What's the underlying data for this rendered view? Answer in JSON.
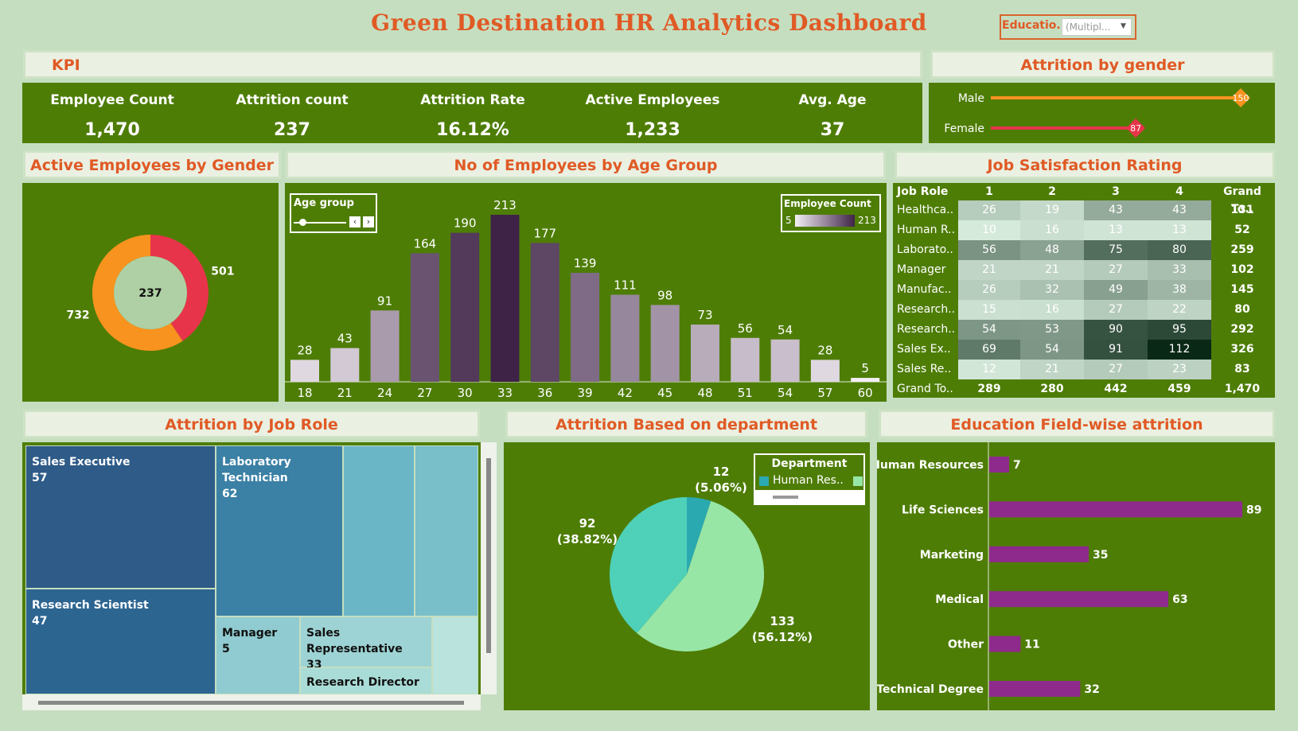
{
  "title": "Green Destination HR Analytics Dashboard",
  "filter": {
    "label": "Educatio..",
    "value": "(Multipl..."
  },
  "kpi": {
    "header": "KPI",
    "items": [
      {
        "label": "Employee Count",
        "value": "1,470"
      },
      {
        "label": "Attrition count",
        "value": "237"
      },
      {
        "label": "Attrition Rate",
        "value": "16.12%"
      },
      {
        "label": "Active Employees",
        "value": "1,233"
      },
      {
        "label": "Avg. Age",
        "value": "37"
      }
    ]
  },
  "colors": {
    "panel_green": "#4e7d06",
    "header_orange": "#e05a25",
    "male_orange": "#f7931e",
    "female_red": "#e8344a",
    "edu_bar": "#8e2a8c"
  },
  "chart_data": [
    {
      "id": "attrition_by_gender",
      "type": "bar",
      "title": "Attrition by gender",
      "categories": [
        "Male",
        "Female"
      ],
      "values": [
        150,
        87
      ],
      "xlim": [
        0,
        165
      ]
    },
    {
      "id": "active_by_gender",
      "type": "pie",
      "title": "Active Employees by Gender",
      "center_label": "237",
      "slices": [
        {
          "value": 501,
          "color": "#e8344a"
        },
        {
          "value": 732,
          "color": "#f7931e"
        }
      ]
    },
    {
      "id": "age_group",
      "type": "bar",
      "title": "No of Employees by Age Group",
      "categories": [
        "18",
        "21",
        "24",
        "27",
        "30",
        "33",
        "36",
        "39",
        "42",
        "45",
        "48",
        "51",
        "54",
        "57",
        "60"
      ],
      "values": [
        28,
        43,
        91,
        164,
        190,
        213,
        177,
        139,
        111,
        98,
        73,
        56,
        54,
        28,
        5
      ],
      "color_scale": {
        "title": "Employee Count",
        "min": 5,
        "max": 213
      },
      "filter_label": "Age group"
    },
    {
      "id": "job_satisfaction",
      "type": "heatmap",
      "title": "Job Satisfaction Rating",
      "columns": [
        "Job Role",
        "1",
        "2",
        "3",
        "4",
        "Grand To.."
      ],
      "rows": [
        {
          "label": "Healthca..",
          "values": [
            26,
            19,
            43,
            43
          ],
          "total": "131"
        },
        {
          "label": "Human R..",
          "values": [
            10,
            16,
            13,
            13
          ],
          "total": "52"
        },
        {
          "label": "Laborato..",
          "values": [
            56,
            48,
            75,
            80
          ],
          "total": "259"
        },
        {
          "label": "Manager",
          "values": [
            21,
            21,
            27,
            33
          ],
          "total": "102"
        },
        {
          "label": "Manufac..",
          "values": [
            26,
            32,
            49,
            38
          ],
          "total": "145"
        },
        {
          "label": "Research..",
          "values": [
            15,
            16,
            27,
            22
          ],
          "total": "80"
        },
        {
          "label": "Research..",
          "values": [
            54,
            53,
            90,
            95
          ],
          "total": "292"
        },
        {
          "label": "Sales Ex..",
          "values": [
            69,
            54,
            91,
            112
          ],
          "total": "326"
        },
        {
          "label": "Sales Re..",
          "values": [
            12,
            21,
            27,
            23
          ],
          "total": "83"
        }
      ],
      "grand_total": {
        "label": "Grand To..",
        "values": [
          "289",
          "280",
          "442",
          "459"
        ],
        "total": "1,470"
      }
    },
    {
      "id": "attrition_by_job_role",
      "type": "treemap",
      "title": "Attrition by Job Role",
      "items": [
        {
          "name": "Sales Executive",
          "value": "57"
        },
        {
          "name": "Research Scientist",
          "value": "47"
        },
        {
          "name": "Laboratory Technician",
          "value": "62"
        },
        {
          "name": "Manager",
          "value": "5"
        },
        {
          "name": "Sales Representative",
          "value": "33"
        },
        {
          "name": "Research Director",
          "value": ""
        }
      ]
    },
    {
      "id": "attrition_by_department",
      "type": "pie",
      "title": "Attrition Based on department",
      "legend_title": "Department",
      "legend_items": [
        "Human Res.."
      ],
      "slices": [
        {
          "value": 12,
          "label": "12",
          "pct": "(5.06%)",
          "color": "#2aa9b0"
        },
        {
          "value": 133,
          "label": "133",
          "pct": "(56.12%)",
          "color": "#98e6a6"
        },
        {
          "value": 92,
          "label": "92",
          "pct": "(38.82%)",
          "color": "#4ed1b8"
        }
      ]
    },
    {
      "id": "education_field_attrition",
      "type": "bar",
      "title": "Education Field-wise attrition",
      "categories": [
        "Human Resources",
        "Life Sciences",
        "Marketing",
        "Medical",
        "Other",
        "Technical Degree"
      ],
      "values": [
        7,
        89,
        35,
        63,
        11,
        32
      ],
      "xlim": [
        0,
        89
      ]
    }
  ]
}
